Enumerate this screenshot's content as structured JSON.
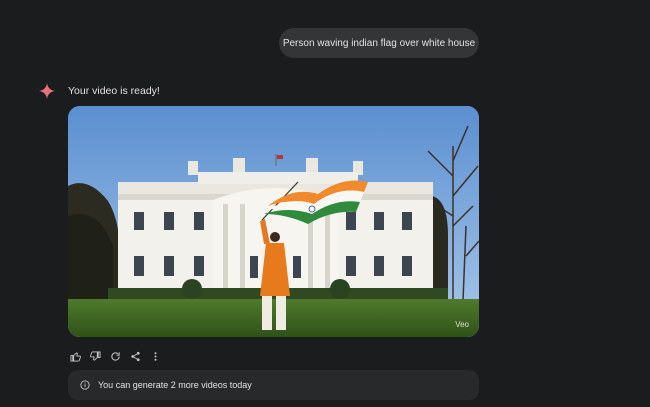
{
  "chat": {
    "user_prompt": "Person waving indian flag over white house",
    "assistant_message": "Your video is ready!"
  },
  "video": {
    "watermark": "Veo",
    "description_icon": "video-player"
  },
  "actions": {
    "icons": [
      "thumb-up-icon",
      "thumb-down-icon",
      "regenerate-icon",
      "share-icon",
      "more-vert-icon"
    ]
  },
  "notice": {
    "text": "You can generate 2 more videos today",
    "icon": "info-icon"
  },
  "colors": {
    "background": "#1b1c1d",
    "bubble": "#333537",
    "notice_bg": "#28292a",
    "sparkle": "#e4727f",
    "text": "#e3e3e3"
  }
}
